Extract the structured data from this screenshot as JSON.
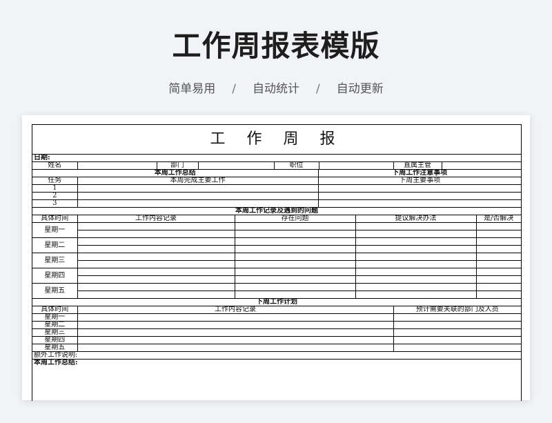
{
  "hero": {
    "title": "工作周报表模版",
    "tags": [
      "简单易用",
      "自动统计",
      "自动更新"
    ],
    "separator": "/"
  },
  "form": {
    "title": "工 作 周 报",
    "date_label": "日期:",
    "info_labels": {
      "name": "姓名",
      "dept": "部门",
      "position": "职位",
      "supervisor": "直属主管"
    },
    "summary_section": "本周工作总结",
    "notes_section": "下周工作注意事项",
    "task_header": "任务",
    "task_main_header": "本周完成主要工作",
    "next_main_header": "下周主要事项",
    "task_numbers": [
      "1",
      "2",
      "3"
    ],
    "record_section": "本周工作记录及遇到的问题",
    "record_headers": [
      "具体时间",
      "工作内容记录",
      "存在问题",
      "提议解决办法",
      "是/否解决"
    ],
    "weekdays": [
      "星期一",
      "星期二",
      "星期三",
      "星期四",
      "星期五"
    ],
    "plan_section": "下周工作计划",
    "plan_headers": [
      "具体时间",
      "工作内容记录",
      "预计需要关联的部门及人员"
    ],
    "extra_label": "额外工作说明:",
    "week_summary_label": "本周工作总结:"
  }
}
